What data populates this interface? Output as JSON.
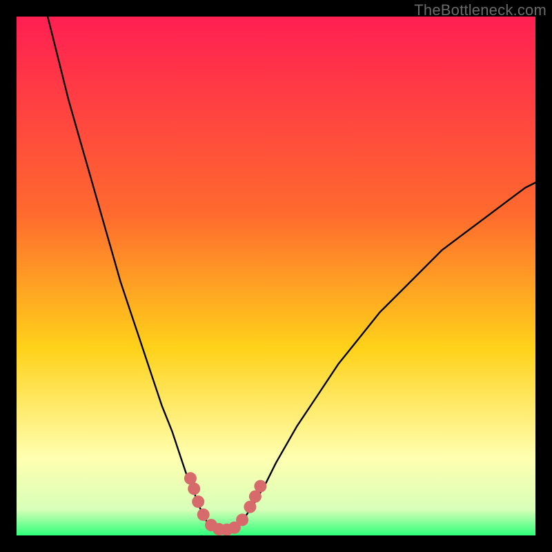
{
  "watermark": "TheBottleneck.com",
  "colors": {
    "gradient_top": "#ff1f52",
    "gradient_mid_upper": "#ff6a2e",
    "gradient_mid": "#ffd21a",
    "gradient_pale": "#ffffb0",
    "gradient_green": "#2eff7a",
    "curve": "#000000",
    "marker_fill": "#d76b6b",
    "marker_stroke": "#b84f4f"
  },
  "chart_data": {
    "type": "line",
    "title": "",
    "xlabel": "",
    "ylabel": "",
    "xlim": [
      0,
      100
    ],
    "ylim": [
      0,
      100
    ],
    "curve": {
      "x": [
        6,
        8,
        10,
        12,
        14,
        16,
        18,
        20,
        22,
        24,
        26,
        28,
        30,
        31,
        32,
        33,
        34,
        35,
        36,
        37,
        38,
        39,
        40,
        41,
        42,
        43,
        44,
        46,
        48,
        50,
        54,
        58,
        62,
        66,
        70,
        74,
        78,
        82,
        86,
        90,
        94,
        98,
        100
      ],
      "y": [
        100,
        92,
        84,
        77,
        70,
        63,
        56,
        49,
        43,
        37,
        31,
        25,
        20,
        17,
        14,
        11,
        9,
        6,
        4,
        2,
        1.2,
        1.0,
        1.0,
        1.1,
        1.4,
        2.2,
        3.5,
        6.5,
        10,
        14,
        21,
        27,
        33,
        38,
        43,
        47,
        51,
        55,
        58,
        61,
        64,
        67,
        68
      ]
    },
    "markers": [
      {
        "x": 33.5,
        "y": 11.0
      },
      {
        "x": 34.2,
        "y": 9.0
      },
      {
        "x": 35.0,
        "y": 6.5
      },
      {
        "x": 36.0,
        "y": 4.0
      },
      {
        "x": 37.5,
        "y": 2.0
      },
      {
        "x": 39.0,
        "y": 1.2
      },
      {
        "x": 40.5,
        "y": 1.1
      },
      {
        "x": 42.0,
        "y": 1.5
      },
      {
        "x": 43.5,
        "y": 3.0
      },
      {
        "x": 45.0,
        "y": 5.5
      },
      {
        "x": 46.0,
        "y": 7.5
      },
      {
        "x": 47.0,
        "y": 9.5
      }
    ]
  }
}
